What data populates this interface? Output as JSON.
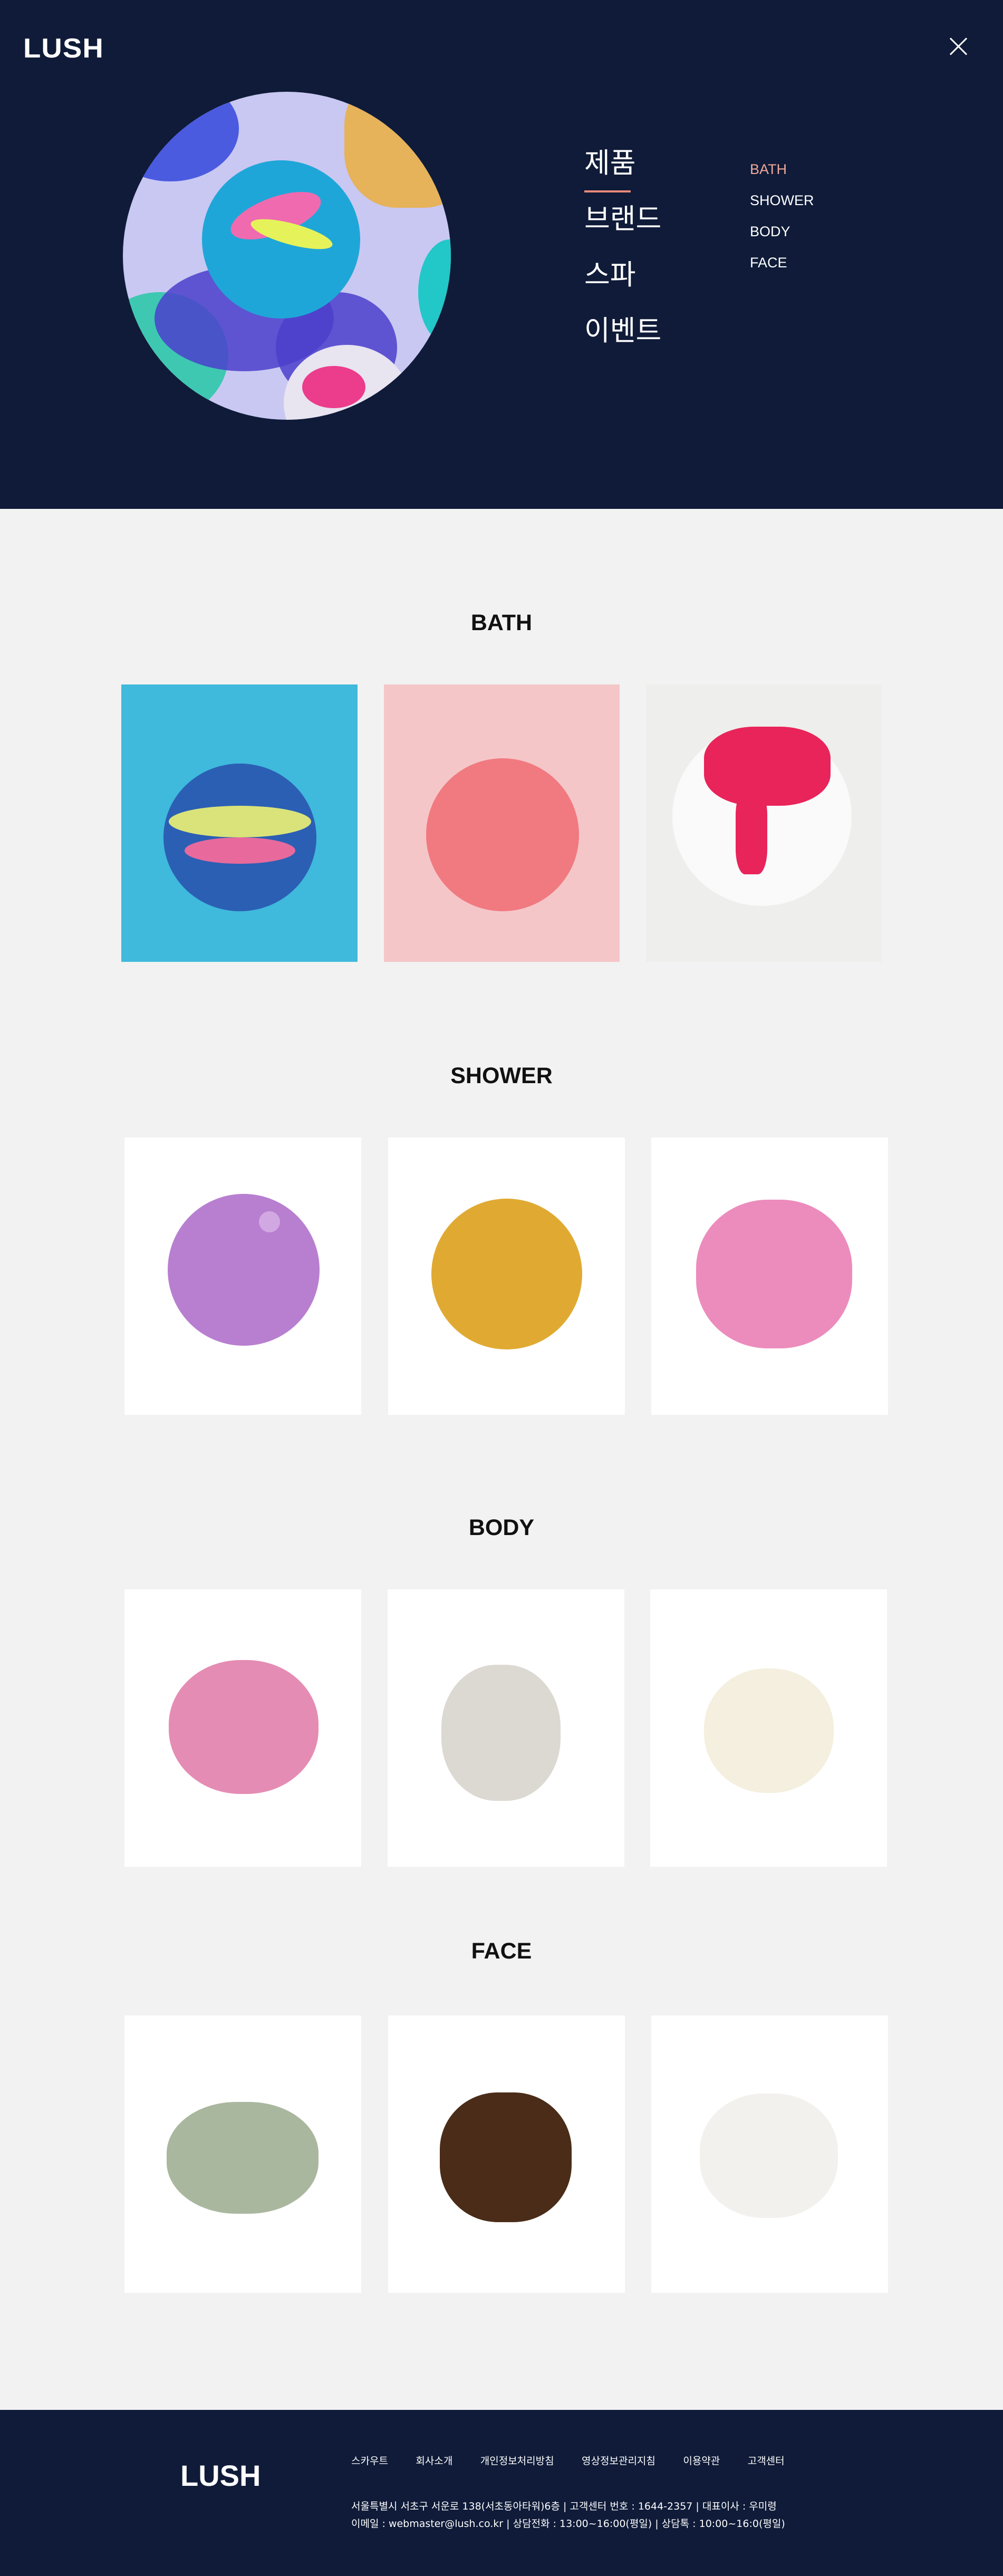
{
  "header": {
    "logo": "LUSH",
    "main_menu": [
      "제품",
      "브랜드",
      "스파",
      "이벤트"
    ],
    "sub_menu": [
      "BATH",
      "SHOWER",
      "BODY",
      "FACE"
    ]
  },
  "sections": {
    "bath": {
      "title": "BATH"
    },
    "shower": {
      "title": "SHOWER"
    },
    "body": {
      "title": "BODY"
    },
    "face": {
      "title": "FACE"
    }
  },
  "colors": {
    "navy": "#0f1b38",
    "accent": "#e8897a",
    "page_bg": "#f2f2f2"
  },
  "footer": {
    "logo": "LUSH",
    "links": [
      "스카우트",
      "회사소개",
      "개인정보처리방침",
      "영상정보관리지침",
      "이용약관",
      "고객센터"
    ],
    "info_line1": "서울특별시 서초구 서운로 138(서초동아타워)6층  |  고객센터 번호 : 1644-2357  |  대표이사 : 우미령",
    "info_line2": "이메일 : webmaster@lush.co.kr | 상담전화 : 13:00~16:00(평일)  |  상담톡 : 10:00~16:0(평일)"
  }
}
